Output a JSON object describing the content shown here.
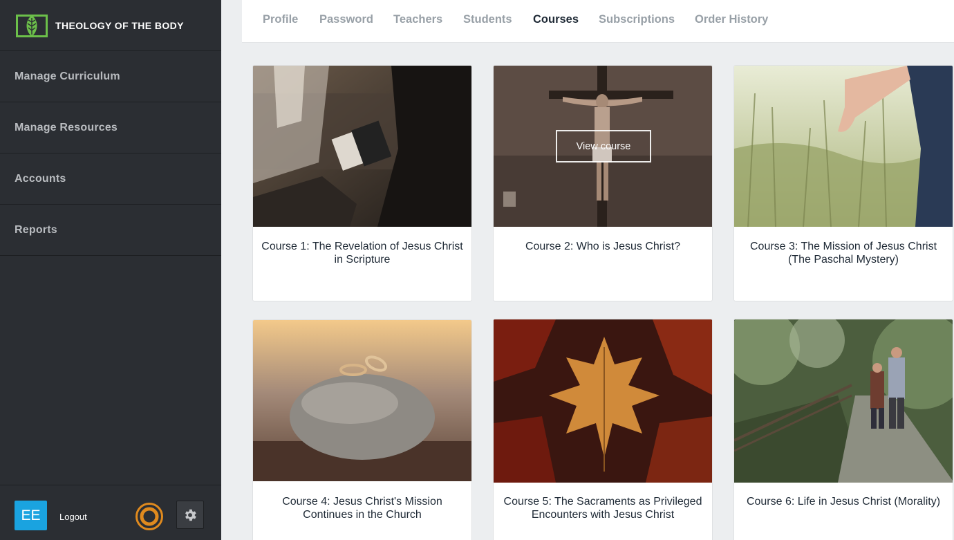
{
  "brand": {
    "name": "THEOLOGY OF THE BODY",
    "logo_icon": "book-leaf-icon",
    "accent": "#6cc04a"
  },
  "sidebar": {
    "items": [
      {
        "label": "Manage Curriculum"
      },
      {
        "label": "Manage Resources"
      },
      {
        "label": "Accounts"
      },
      {
        "label": "Reports"
      }
    ],
    "footer": {
      "avatar_initials": "EE",
      "logout_label": "Logout",
      "ring_icon": "ring-icon",
      "settings_icon": "gear-icon"
    }
  },
  "tabs": [
    {
      "label": "Profile",
      "active": false
    },
    {
      "label": "Password",
      "active": false
    },
    {
      "label": "Teachers",
      "active": false
    },
    {
      "label": "Students",
      "active": false
    },
    {
      "label": "Courses",
      "active": true
    },
    {
      "label": "Subscriptions",
      "active": false
    },
    {
      "label": "Order History",
      "active": false
    }
  ],
  "courses": [
    {
      "title": "Course 1: The Revelation of Jesus Christ in Scripture"
    },
    {
      "title": "Course 2: Who is Jesus Christ?",
      "hover_label": "View course"
    },
    {
      "title": "Course 3: The Mission of Jesus Christ (The Paschal Mystery)"
    },
    {
      "title": "Course 4: Jesus Christ's Mission Continues in the Church"
    },
    {
      "title": "Course 5: The Sacraments as Privileged Encounters with Jesus Christ"
    },
    {
      "title": "Course 6: Life in Jesus Christ (Morality)"
    }
  ],
  "colors": {
    "sidebar_bg": "#2b2e33",
    "avatar_bg": "#1aa3e0",
    "ring": "#e08a1e",
    "active_tab": "#1f2a36"
  }
}
